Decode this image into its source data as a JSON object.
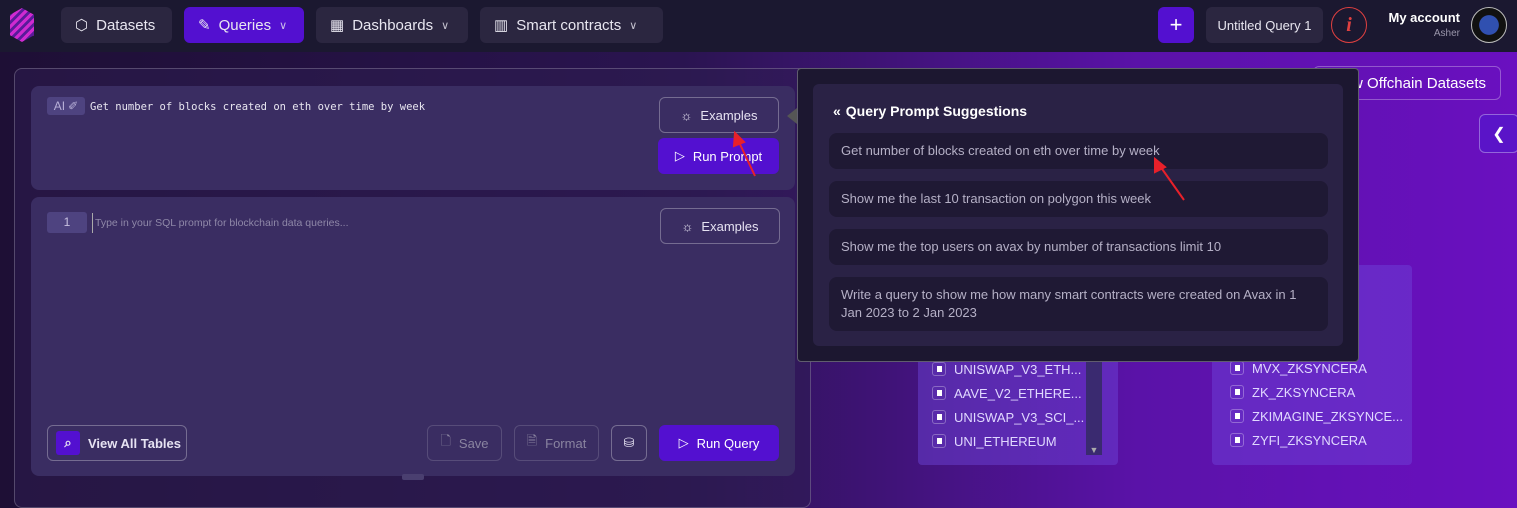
{
  "nav": {
    "datasets": "Datasets",
    "queries": "Queries",
    "dashboards": "Dashboards",
    "smart_contracts": "Smart contracts"
  },
  "header": {
    "new_label": "+",
    "query_tab": "Untitled Query 1",
    "info": "i",
    "account": "My account",
    "user": "Asher"
  },
  "prompt": {
    "ai_badge": "AI",
    "text": "Get number of blocks created on eth over time by week",
    "examples": "Examples",
    "run": "Run Prompt"
  },
  "editor": {
    "line": "1",
    "placeholder": "Type in your SQL prompt for blockchain data queries...",
    "examples": "Examples",
    "view_tables": "View All Tables",
    "save": "Save",
    "format": "Format",
    "run": "Run Query"
  },
  "offchain": "View Offchain Datasets",
  "suggestions": {
    "title": "Query Prompt Suggestions",
    "items": [
      "Get number of blocks created on eth over time by week",
      "Show me the last 10 transaction on polygon this week",
      "Show me the top users on avax by number of transactions limit 10",
      "Write a query to show me how many smart contracts were created on Avax in 1 Jan 2023 to 2 Jan 2023"
    ]
  },
  "bg_tables": {
    "left": [
      "UNISWAP_V3_ETH...",
      "AAVE_V2_ETHERE...",
      "UNISWAP_V3_SCI_...",
      "UNI_ETHEREUM"
    ],
    "right_partial": "RA",
    "right": [
      "MVX_ZKSYNCERA",
      "ZK_ZKSYNCERA",
      "ZKIMAGINE_ZKSYNCE...",
      "ZYFI_ZKSYNCERA"
    ]
  },
  "colors": {
    "accent": "#5310d0",
    "topbar": "#1b1830",
    "info": "#e04040"
  }
}
